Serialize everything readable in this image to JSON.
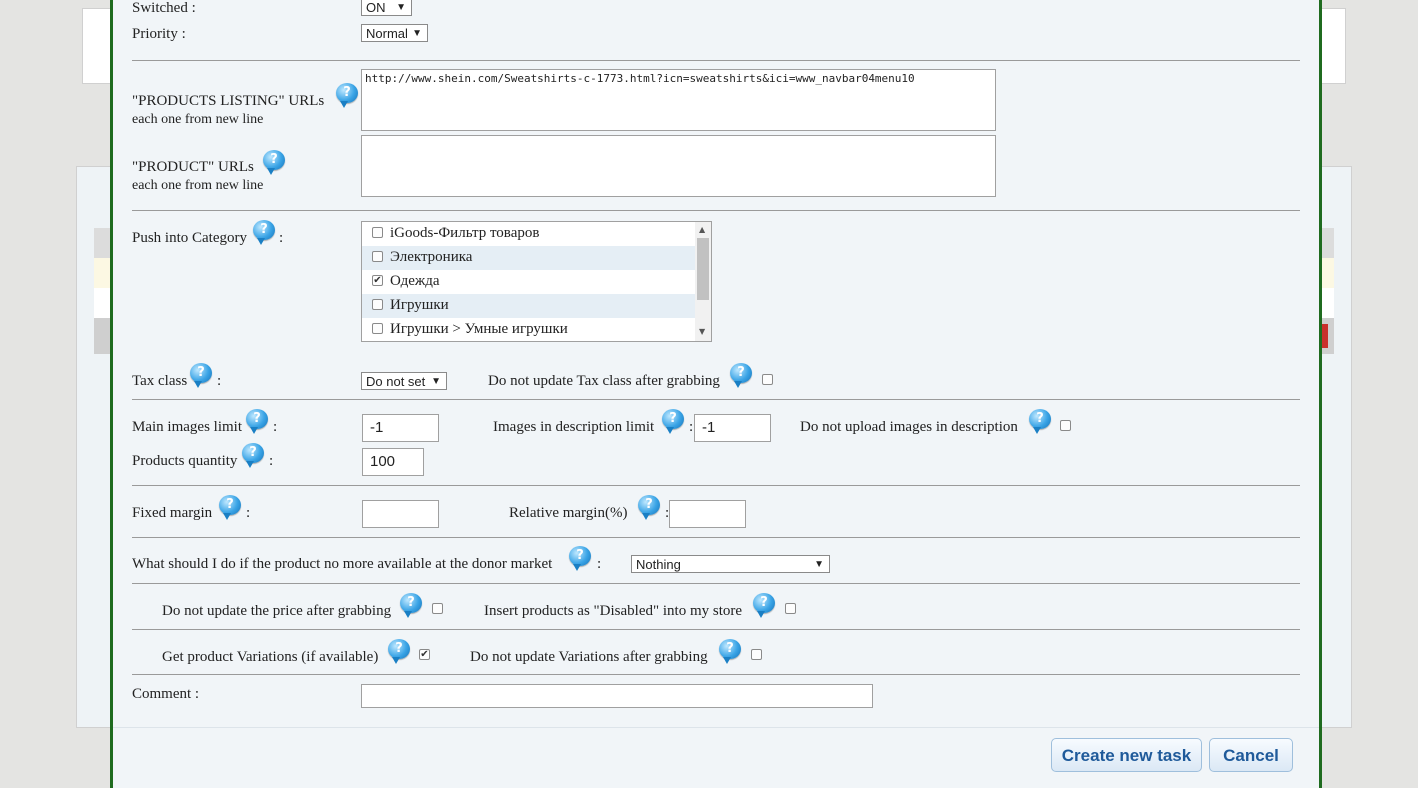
{
  "form": {
    "switched_label": "Switched :",
    "switched_value": "ON",
    "priority_label": "Priority :",
    "priority_value": "Normal",
    "listing_urls_label": "\"PRODUCTS LISTING\" URLs",
    "listing_urls_sub": "each one from new line",
    "listing_urls_value": "http://www.shein.com/Sweatshirts-c-1773.html?icn=sweatshirts&ici=www_navbar04menu10",
    "product_urls_label": "\"PRODUCT\" URLs",
    "product_urls_sub": "each one from new line",
    "product_urls_value": "",
    "category_label": "Push into Category",
    "colon": ":",
    "categories": [
      {
        "label": "iGoods-Фильтр товаров",
        "checked": false
      },
      {
        "label": "Электроника",
        "checked": false
      },
      {
        "label": "Одежда",
        "checked": true
      },
      {
        "label": "Игрушки",
        "checked": false
      },
      {
        "label": "Игрушки > Умные игрушки",
        "checked": false
      }
    ],
    "tax_class_label": "Tax class",
    "tax_class_value": "Do not set",
    "no_update_tax_label": "Do not update Tax class after grabbing",
    "main_images_label": "Main images limit",
    "main_images_value": "-1",
    "desc_images_label": "Images in description limit",
    "desc_images_value": "-1",
    "no_upload_desc_images_label": "Do not upload images in description",
    "products_qty_label": "Products quantity",
    "products_qty_value": "100",
    "fixed_margin_label": "Fixed margin",
    "fixed_margin_value": "",
    "relative_margin_label": "Relative margin(%)",
    "relative_margin_value": "",
    "unavailable_label": "What should I do if the product no more available at the donor market",
    "unavailable_value": "Nothing",
    "no_update_price_label": "Do not update the price after grabbing",
    "insert_disabled_label": "Insert products as \"Disabled\" into my store",
    "get_variations_label": "Get product Variations (if available)",
    "no_update_variations_label": "Do not update Variations after grabbing",
    "comment_label": "Comment :",
    "comment_value": ""
  },
  "buttons": {
    "create": "Create new task",
    "cancel": "Cancel"
  },
  "icons": {
    "help": "?",
    "dropdown": "▼",
    "check": "✔",
    "scroll_up": "▲",
    "scroll_down": "▼"
  },
  "colors": {
    "modal_border": "#1f6b1f",
    "modal_bg": "#f1f5f8",
    "button_text": "#1f5a9a",
    "help_icon": "#3aa4e6"
  }
}
